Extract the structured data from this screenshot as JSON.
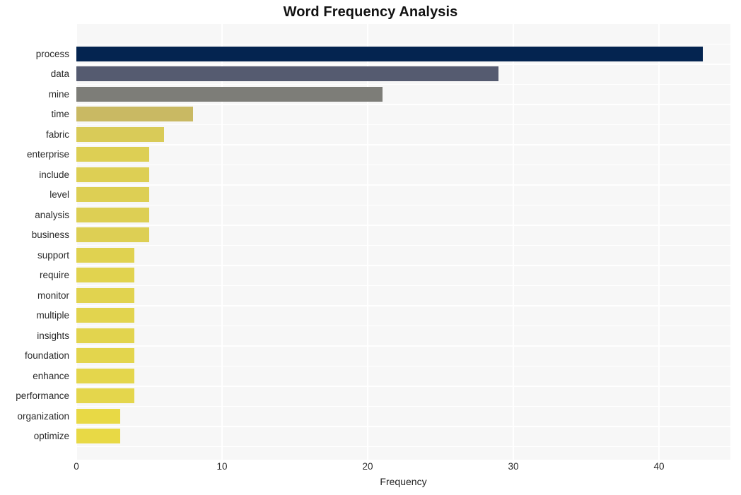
{
  "chart_data": {
    "type": "bar",
    "orientation": "horizontal",
    "title": "Word Frequency Analysis",
    "xlabel": "Frequency",
    "ylabel": "",
    "xlim": [
      0,
      44.9
    ],
    "xticks": [
      0,
      10,
      20,
      30,
      40
    ],
    "xticklabels": [
      "0",
      "10",
      "20",
      "30",
      "40"
    ],
    "grid": true,
    "legend": null,
    "categories": [
      "process",
      "data",
      "mine",
      "time",
      "fabric",
      "enterprise",
      "include",
      "level",
      "analysis",
      "business",
      "support",
      "require",
      "monitor",
      "multiple",
      "insights",
      "foundation",
      "enhance",
      "performance",
      "organization",
      "optimize"
    ],
    "values": [
      43,
      29,
      21,
      8,
      6,
      5,
      5,
      5,
      5,
      5,
      4,
      4,
      4,
      4,
      4,
      4,
      4,
      4,
      3,
      3
    ],
    "bar_colors": [
      "#042450",
      "#555b70",
      "#7d7d78",
      "#c9b963",
      "#d9cb58",
      "#ddcf54",
      "#ddcf54",
      "#ddcf54",
      "#ddcf54",
      "#ddcf54",
      "#e0d250",
      "#e1d34f",
      "#e1d34f",
      "#e2d44e",
      "#e2d44e",
      "#e3d54d",
      "#e4d64c",
      "#e4d64c",
      "#e8d945",
      "#e8d945"
    ]
  },
  "style": {
    "plot_background": "#f7f7f7",
    "figure_background": "#ffffff",
    "gridline_color": "#ffffff",
    "tick_text_color": "#2a2a2a",
    "title_color": "#121212"
  }
}
